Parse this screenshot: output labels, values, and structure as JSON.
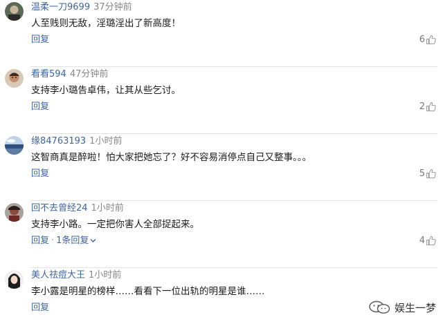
{
  "comments": [
    {
      "username": "温柔一刀9699",
      "time": "37分钟前",
      "text": "人至贱则无敌，淫璐淫出了新高度！",
      "reply": "回复",
      "likes": "6"
    },
    {
      "username": "看看594",
      "time": "47分钟前",
      "text": "支持李小璐告卓伟，让其从些乞讨。",
      "reply": "回复",
      "likes": "2"
    },
    {
      "username": "缘84763193",
      "time": "1小时前",
      "text": "这智商真是醉啦！怕大家把她忘了？好不容易消停点自己又整事。。。",
      "reply": "回复",
      "likes": "5"
    },
    {
      "username": "回不去曾经24",
      "time": "1小时前",
      "text": "支持李小路。一定把你害人全部捉起来。",
      "reply": "回复",
      "sub_replies": "1条回复",
      "likes": "4"
    },
    {
      "username": "美人祛痘大王",
      "time": "1小时前",
      "text": "李小露是明星的榜样……看看下一位出轨的明星是谁……",
      "reply": "回复",
      "likes": ""
    }
  ],
  "watermark": "娱生一梦",
  "colors": {
    "username": "#406599",
    "time": "#888888",
    "text": "#1a1a1a",
    "likes": "#777777"
  }
}
